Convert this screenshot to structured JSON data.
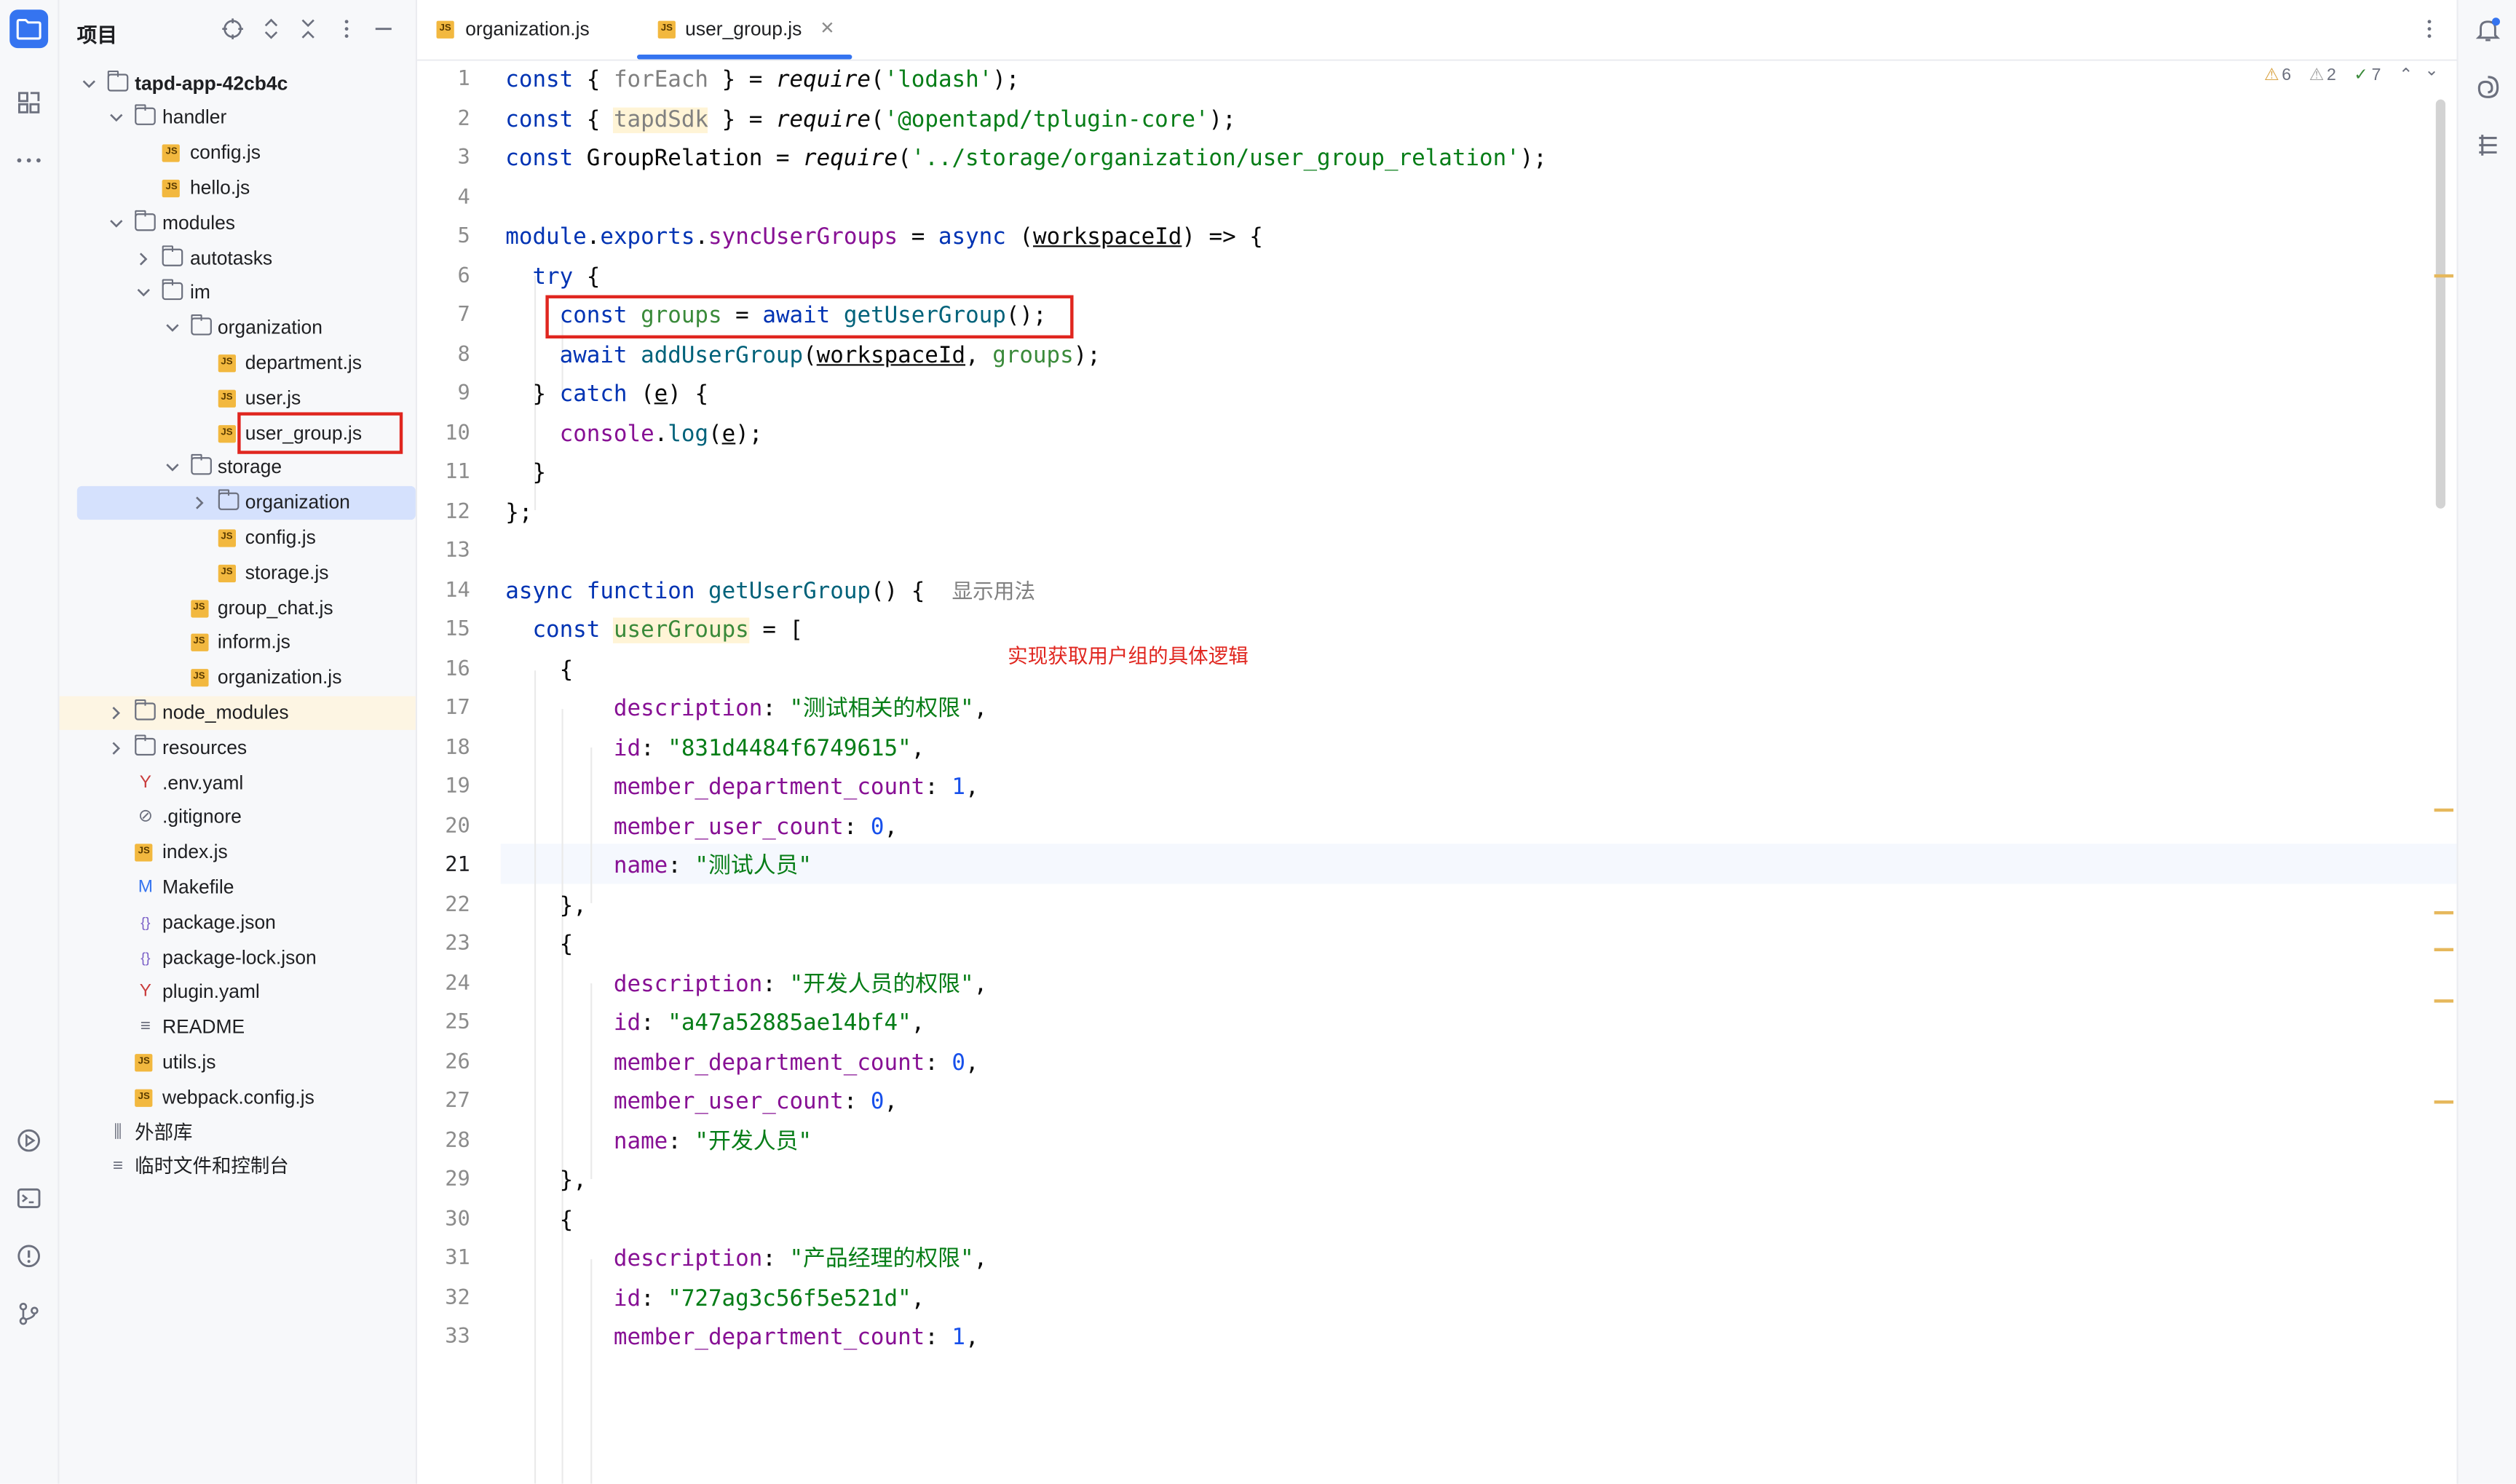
{
  "project": {
    "title": "项目",
    "root": "tapd-app-42cb4c",
    "items": [
      {
        "label": "handler",
        "type": "folder",
        "depth": 1,
        "open": true
      },
      {
        "label": "config.js",
        "type": "js",
        "depth": 2
      },
      {
        "label": "hello.js",
        "type": "js",
        "depth": 2
      },
      {
        "label": "modules",
        "type": "folder",
        "depth": 1,
        "open": true
      },
      {
        "label": "autotasks",
        "type": "folder",
        "depth": 2,
        "open": false
      },
      {
        "label": "im",
        "type": "folder",
        "depth": 2,
        "open": true
      },
      {
        "label": "organization",
        "type": "folder",
        "depth": 3,
        "open": true
      },
      {
        "label": "department.js",
        "type": "js",
        "depth": 4
      },
      {
        "label": "user.js",
        "type": "js",
        "depth": 4
      },
      {
        "label": "user_group.js",
        "type": "js",
        "depth": 4
      },
      {
        "label": "storage",
        "type": "folder",
        "depth": 3,
        "open": true
      },
      {
        "label": "organization",
        "type": "folder",
        "depth": 4,
        "open": false
      },
      {
        "label": "config.js",
        "type": "js",
        "depth": 4
      },
      {
        "label": "storage.js",
        "type": "js",
        "depth": 4
      },
      {
        "label": "group_chat.js",
        "type": "js",
        "depth": 3
      },
      {
        "label": "inform.js",
        "type": "js",
        "depth": 3
      },
      {
        "label": "organization.js",
        "type": "js",
        "depth": 3
      },
      {
        "label": "node_modules",
        "type": "folder",
        "depth": 1,
        "open": false
      },
      {
        "label": "resources",
        "type": "folder",
        "depth": 1,
        "open": false
      },
      {
        "label": ".env.yaml",
        "type": "yaml",
        "depth": 1
      },
      {
        "label": ".gitignore",
        "type": "ignore",
        "depth": 1
      },
      {
        "label": "index.js",
        "type": "js",
        "depth": 1
      },
      {
        "label": "Makefile",
        "type": "make",
        "depth": 1
      },
      {
        "label": "package.json",
        "type": "json",
        "depth": 1
      },
      {
        "label": "package-lock.json",
        "type": "json",
        "depth": 1
      },
      {
        "label": "plugin.yaml",
        "type": "yaml",
        "depth": 1
      },
      {
        "label": "README",
        "type": "readme",
        "depth": 1
      },
      {
        "label": "utils.js",
        "type": "js",
        "depth": 1
      },
      {
        "label": "webpack.config.js",
        "type": "js",
        "depth": 1
      }
    ],
    "external_libs": "外部库",
    "scratches": "临时文件和控制台"
  },
  "tabs": [
    {
      "label": "organization.js",
      "active": false
    },
    {
      "label": "user_group.js",
      "active": true
    }
  ],
  "inspections": {
    "warnings": "6",
    "weak_warnings": "2",
    "ok": "7"
  },
  "annotation": "实现获取用户组的具体逻辑",
  "inlay_hint": "显示用法",
  "line_numbers": [
    "1",
    "2",
    "3",
    "4",
    "5",
    "6",
    "7",
    "8",
    "9",
    "10",
    "11",
    "12",
    "13",
    "14",
    "15",
    "16",
    "17",
    "18",
    "19",
    "20",
    "21",
    "22",
    "23",
    "24",
    "25",
    "26",
    "27",
    "28",
    "29",
    "30",
    "31",
    "32",
    "33"
  ],
  "current_line": "21",
  "code": {
    "l1": {
      "a": "const",
      "b": "{ ",
      "c": "forEach",
      "d": " } = ",
      "e": "require",
      "f": "(",
      "g": "'lodash'",
      "h": ");"
    },
    "l2": {
      "a": "const",
      "b": "{ ",
      "c": "tapdSdk",
      "d": " } = ",
      "e": "require",
      "f": "(",
      "g": "'@opentapd/tplugin-core'",
      "h": ");"
    },
    "l3": {
      "a": "const",
      "b": "GroupRelation = ",
      "e": "require",
      "f": "(",
      "g": "'../storage/organization/user_group_relation'",
      "h": ");"
    },
    "l5": {
      "a": "module",
      "b": ".",
      "c": "exports",
      "d": ".",
      "e": "syncUserGroups",
      "f": " = ",
      "g": "async",
      "h": " (",
      "i": "workspaceId",
      "j": ") => {"
    },
    "l6": {
      "a": "try",
      "b": " {"
    },
    "l7": {
      "a": "const",
      "b": "groups",
      "c": " = ",
      "d": "await",
      "e": "getUserGroup",
      "f": "();"
    },
    "l8": {
      "a": "await",
      "b": "addUserGroup",
      "c": "(",
      "d": "workspaceId",
      "e": ", ",
      "f": "groups",
      "g": ");"
    },
    "l9": {
      "a": "} ",
      "b": "catch",
      "c": " (",
      "d": "e",
      "e": ") {"
    },
    "l10": {
      "a": "console",
      "b": ".",
      "c": "log",
      "d": "(",
      "e": "e",
      "f": ");"
    },
    "l11": {
      "a": "}"
    },
    "l12": {
      "a": "};"
    },
    "l14": {
      "a": "async",
      "b": "function",
      "c": "getUserGroup",
      "d": "() {"
    },
    "l15": {
      "a": "const",
      "b": "userGroups",
      "c": " = ["
    },
    "l16": {
      "a": "{"
    },
    "l17": {
      "k": "description",
      "v": "\"测试相关的权限\"",
      "t": ","
    },
    "l18": {
      "k": "id",
      "v": "\"831d4484f6749615\"",
      "t": ","
    },
    "l19": {
      "k": "member_department_count",
      "v": "1",
      "t": ","
    },
    "l20": {
      "k": "member_user_count",
      "v": "0",
      "t": ","
    },
    "l21": {
      "k": "name",
      "v": "\"测试人员\"",
      "t": ""
    },
    "l22": {
      "a": "},"
    },
    "l23": {
      "a": "{"
    },
    "l24": {
      "k": "description",
      "v": "\"开发人员的权限\"",
      "t": ","
    },
    "l25": {
      "k": "id",
      "v": "\"a47a52885ae14bf4\"",
      "t": ","
    },
    "l26": {
      "k": "member_department_count",
      "v": "0",
      "t": ","
    },
    "l27": {
      "k": "member_user_count",
      "v": "0",
      "t": ","
    },
    "l28": {
      "k": "name",
      "v": "\"开发人员\"",
      "t": ""
    },
    "l29": {
      "a": "},"
    },
    "l30": {
      "a": "{"
    },
    "l31": {
      "k": "description",
      "v": "\"产品经理的权限\"",
      "t": ","
    },
    "l32": {
      "k": "id",
      "v": "\"727ag3c56f5e521d\"",
      "t": ","
    },
    "l33": {
      "k": "member_department_count",
      "v": "1",
      "t": ","
    }
  }
}
